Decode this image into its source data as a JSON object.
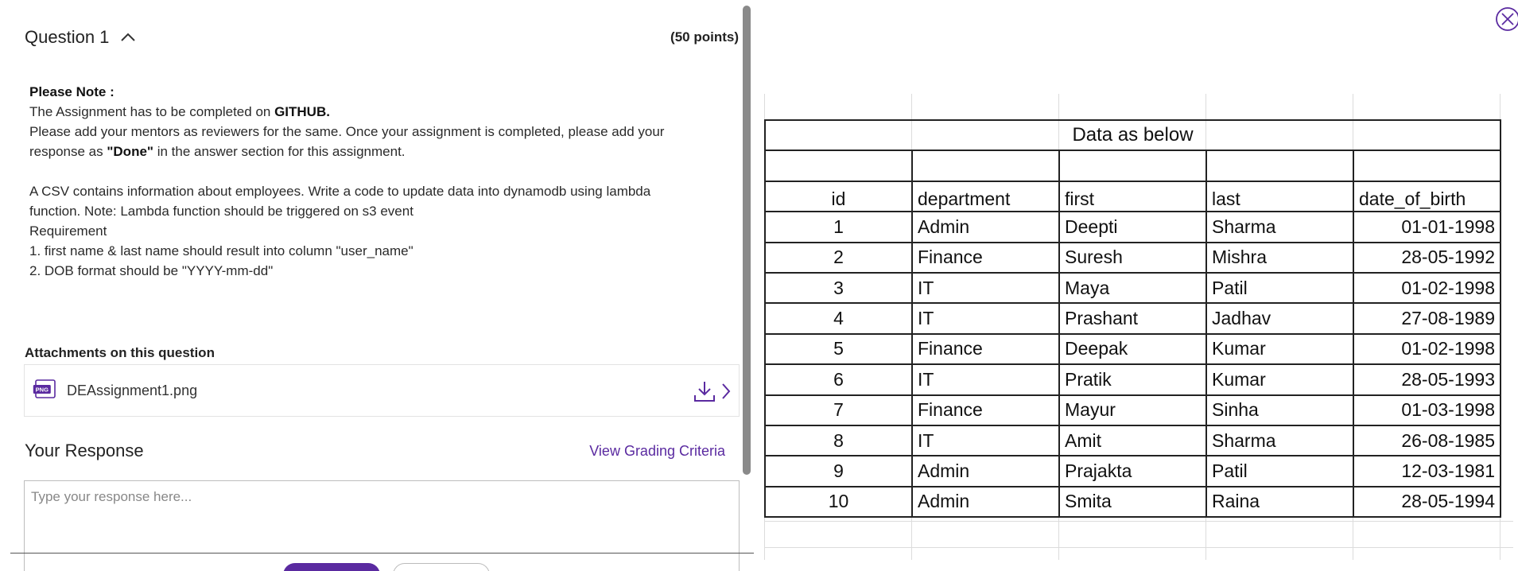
{
  "question": {
    "title": "Question 1",
    "points": "(50 points)"
  },
  "instructions": {
    "note_label": "Please Note :",
    "line1_prefix": "The Assignment has to be completed on ",
    "line1_bold": "GITHUB.",
    "line2": "Please add your mentors as reviewers for the same. Once your assignment is completed, please add your",
    "line3_prefix": "response as ",
    "line3_bold": "\"Done\"",
    "line3_suffix": " in the answer section for this assignment.",
    "para2_line1": "A CSV contains information about employees. Write a code to update data into dynamodb using lambda",
    "para2_line2": "function. Note: Lambda function should be triggered on s3 event",
    "para2_line3": "Requirement",
    "para2_line4": "1. first name & last name should result into column \"user_name\"",
    "para2_line5": "2. DOB format should be \"YYYY-mm-dd\""
  },
  "attachments": {
    "heading": "Attachments on this question",
    "file_name": "DEAssignment1.png",
    "file_badge": "PNG"
  },
  "response": {
    "heading": "Your Response",
    "grading_link": "View Grading Criteria",
    "placeholder": "Type your response here..."
  },
  "image_table": {
    "title": "Data as below",
    "headers": [
      "id",
      "department",
      "first",
      "last",
      "date_of_birth"
    ],
    "rows": [
      [
        "1",
        "Admin",
        "Deepti",
        "Sharma",
        "01-01-1998"
      ],
      [
        "2",
        "Finance",
        "Suresh",
        "Mishra",
        "28-05-1992"
      ],
      [
        "3",
        "IT",
        "Maya",
        "Patil",
        "01-02-1998"
      ],
      [
        "4",
        "IT",
        "Prashant",
        "Jadhav",
        "27-08-1989"
      ],
      [
        "5",
        "Finance",
        "Deepak",
        "Kumar",
        "01-02-1998"
      ],
      [
        "6",
        "IT",
        "Pratik",
        "Kumar",
        "28-05-1993"
      ],
      [
        "7",
        "Finance",
        "Mayur",
        "Sinha",
        "01-03-1998"
      ],
      [
        "8",
        "IT",
        "Amit",
        "Sharma",
        "26-08-1985"
      ],
      [
        "9",
        "Admin",
        "Prajakta",
        "Patil",
        "12-03-1981"
      ],
      [
        "10",
        "Admin",
        "Smita",
        "Raina",
        "28-05-1994"
      ]
    ]
  },
  "colors": {
    "accent": "#5a2aa0",
    "text": "#222222",
    "border": "#bdbdbd"
  },
  "icons": {
    "collapse": "chevron-up-icon",
    "file": "png-file-icon",
    "download": "download-icon",
    "next": "chevron-right-icon",
    "close": "close-icon"
  }
}
